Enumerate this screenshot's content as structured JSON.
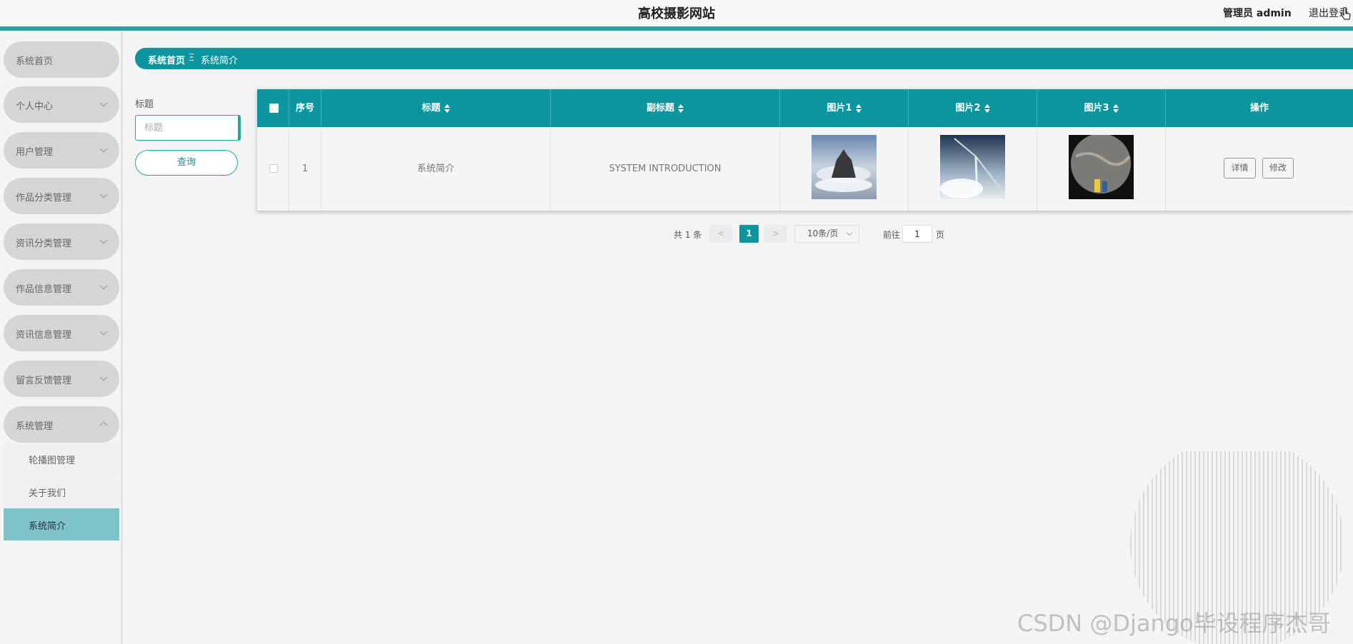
{
  "header": {
    "site_title": "高校摄影网站",
    "user_label": "管理员 admin",
    "logout_label": "退出登录"
  },
  "sidebar": {
    "items": [
      {
        "label": "系统首页"
      },
      {
        "label": "个人中心"
      },
      {
        "label": "用户管理"
      },
      {
        "label": "作品分类管理"
      },
      {
        "label": "资讯分类管理"
      },
      {
        "label": "作品信息管理"
      },
      {
        "label": "资讯信息管理"
      },
      {
        "label": "留言反馈管理"
      },
      {
        "label": "系统管理"
      }
    ],
    "submenu": [
      {
        "label": "轮播图管理"
      },
      {
        "label": "关于我们"
      },
      {
        "label": "系统简介"
      }
    ]
  },
  "breadcrumb": {
    "home": "系统首页",
    "separator": "Ξ",
    "current": "系统简介"
  },
  "search": {
    "label": "标题",
    "placeholder": "标题",
    "button_label": "查询"
  },
  "table": {
    "headers": [
      "序号",
      "标题",
      "副标题",
      "图片1",
      "图片2",
      "图片3",
      "操作"
    ],
    "rows": [
      {
        "index": "1",
        "title": "系统简介",
        "subtitle": "SYSTEM INTRODUCTION",
        "detail_label": "详情",
        "edit_label": "修改"
      }
    ]
  },
  "pagination": {
    "total_text": "共 1 条",
    "prev": "<",
    "current_page": "1",
    "next": ">",
    "page_size": "10条/页",
    "goto_label": "前往",
    "goto_value": "1",
    "page_unit": "页"
  },
  "watermark": "CSDN @Django毕设程序杰哥",
  "colors": {
    "accent": "#0b959e",
    "header_bar": "#2aa0a4",
    "active_menu": "#7fc3c9"
  }
}
